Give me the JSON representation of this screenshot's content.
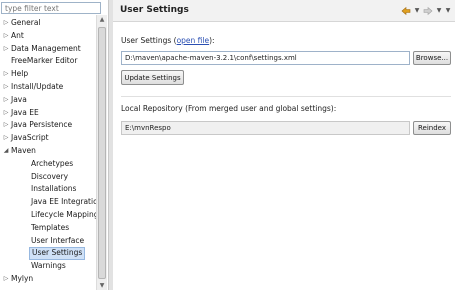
{
  "filter": {
    "placeholder": "type filter text"
  },
  "tree": {
    "items": [
      {
        "label": "General",
        "level": 0,
        "arrow": "▷"
      },
      {
        "label": "Ant",
        "level": 0,
        "arrow": "▷"
      },
      {
        "label": "Data Management",
        "level": 0,
        "arrow": "▷"
      },
      {
        "label": "FreeMarker Editor",
        "level": 0,
        "arrow": ""
      },
      {
        "label": "Help",
        "level": 0,
        "arrow": "▷"
      },
      {
        "label": "Install/Update",
        "level": 0,
        "arrow": "▷"
      },
      {
        "label": "Java",
        "level": 0,
        "arrow": "▷"
      },
      {
        "label": "Java EE",
        "level": 0,
        "arrow": "▷"
      },
      {
        "label": "Java Persistence",
        "level": 0,
        "arrow": "▷"
      },
      {
        "label": "JavaScript",
        "level": 0,
        "arrow": "▷"
      },
      {
        "label": "Maven",
        "level": 0,
        "arrow": "◢"
      },
      {
        "label": "Archetypes",
        "level": 1
      },
      {
        "label": "Discovery",
        "level": 1
      },
      {
        "label": "Installations",
        "level": 1
      },
      {
        "label": "Java EE Integration",
        "level": 1
      },
      {
        "label": "Lifecycle Mapping",
        "level": 1
      },
      {
        "label": "Templates",
        "level": 1
      },
      {
        "label": "User Interface",
        "level": 1
      },
      {
        "label": "User Settings",
        "level": 1,
        "selected": true
      },
      {
        "label": "Warnings",
        "level": 1
      },
      {
        "label": "Mylyn",
        "level": 0,
        "arrow": "▷"
      }
    ]
  },
  "header": {
    "title": "User Settings"
  },
  "user_settings": {
    "label_prefix": "User Settings (",
    "link": "open file",
    "label_suffix": "):",
    "path_value": "D:\\maven\\apache-maven-3.2.1\\conf\\settings.xml",
    "browse_label": "Browse...",
    "update_label": "Update Settings"
  },
  "local_repo": {
    "label": "Local Repository (From merged user and global settings):",
    "value": "E:\\mvnRespo",
    "reindex_label": "Reindex"
  },
  "colors": {
    "accent": "#2a4fb3",
    "selection": "#cfe1f7",
    "nav_back": "#e0a020"
  }
}
